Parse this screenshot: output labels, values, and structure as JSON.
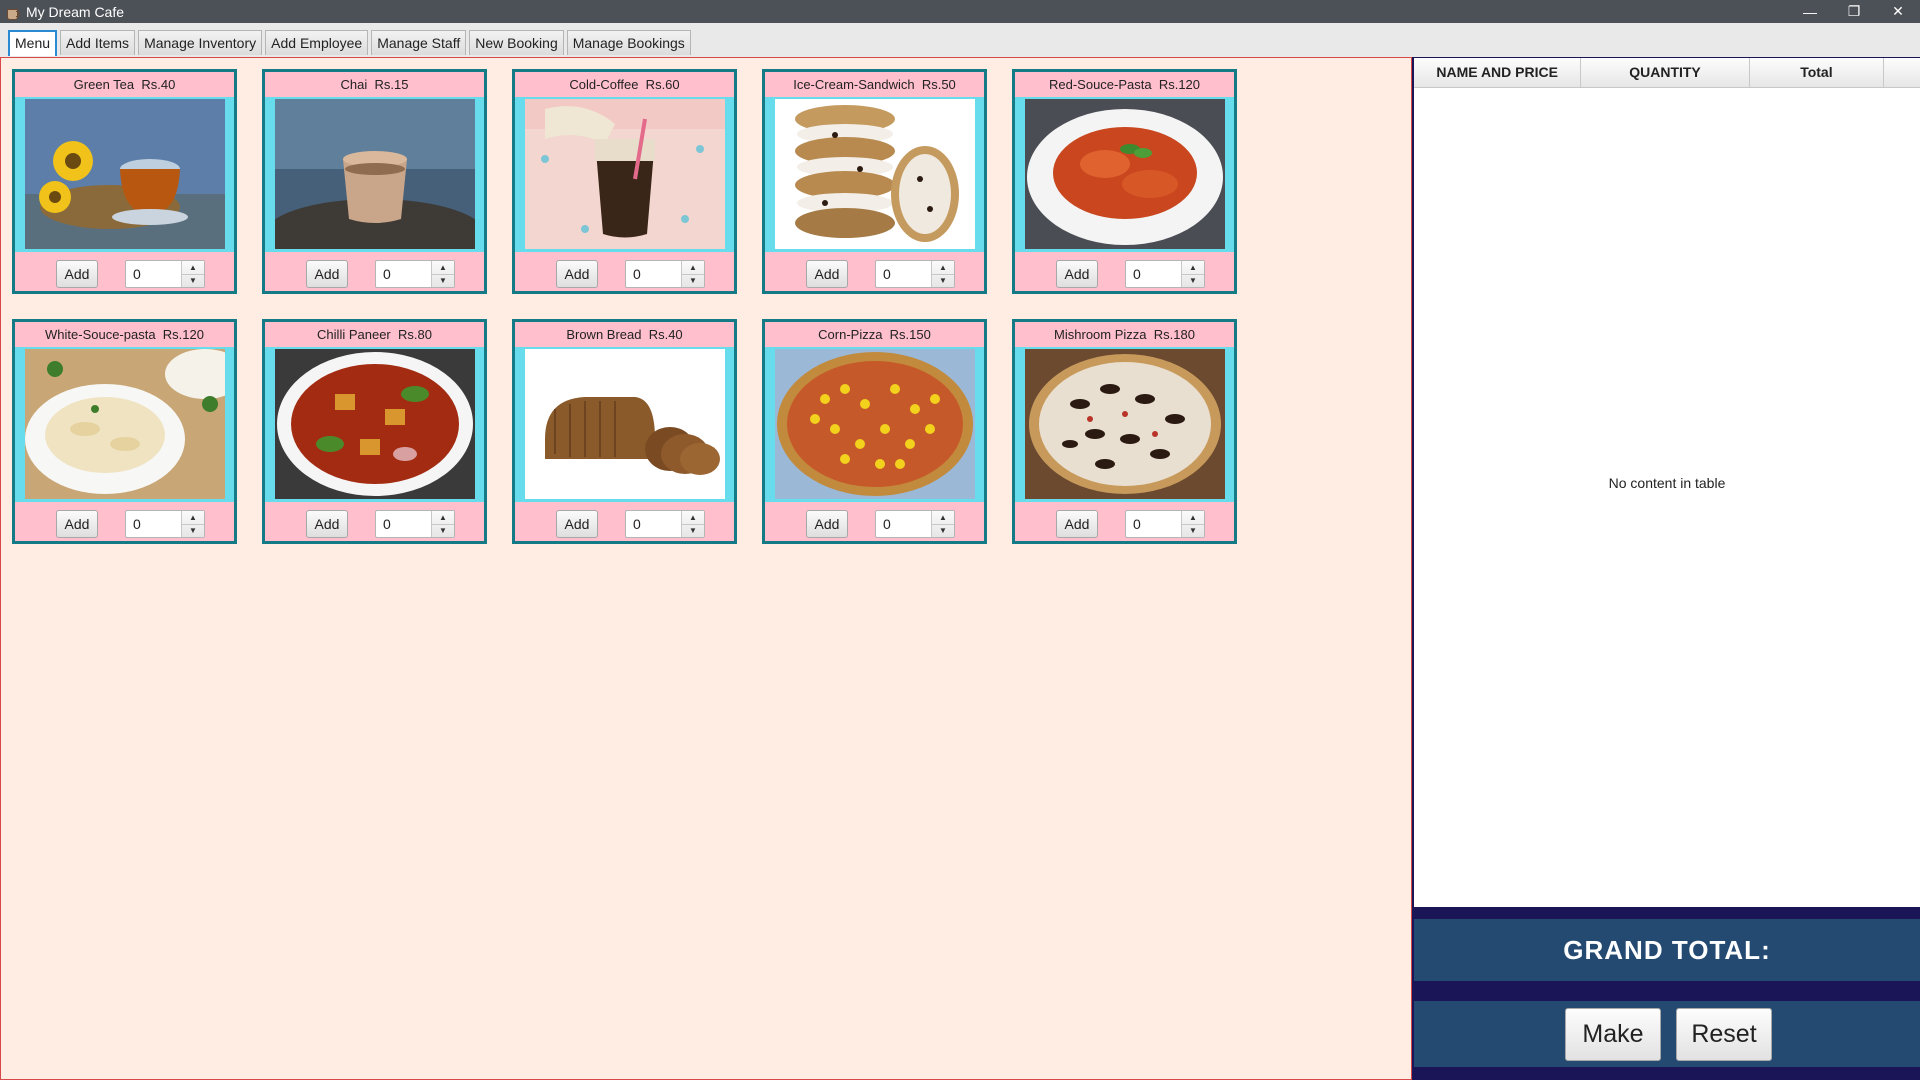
{
  "window": {
    "title": "My Dream Cafe",
    "controls": {
      "minimize": "—",
      "restore": "❐",
      "close": "✕"
    }
  },
  "tabs": [
    "Menu",
    "Add Items",
    "Manage Inventory",
    "Add Employee",
    "Manage Staff",
    "New Booking",
    "Manage Bookings"
  ],
  "active_tab": "Menu",
  "add_label": "Add",
  "menu_items": [
    {
      "name": "Green Tea",
      "price": "Rs.40",
      "label": "Green Tea  Rs.40",
      "qty": "0"
    },
    {
      "name": "Chai",
      "price": "Rs.15",
      "label": "Chai  Rs.15",
      "qty": "0"
    },
    {
      "name": "Cold-Coffee",
      "price": "Rs.60",
      "label": "Cold-Coffee  Rs.60",
      "qty": "0"
    },
    {
      "name": "Ice-Cream-Sandwich",
      "price": "Rs.50",
      "label": "Ice-Cream-Sandwich  Rs.50",
      "qty": "0"
    },
    {
      "name": "Red-Souce-Pasta",
      "price": "Rs.120",
      "label": "Red-Souce-Pasta  Rs.120",
      "qty": "0"
    },
    {
      "name": "White-Souce-pasta",
      "price": "Rs.120",
      "label": "White-Souce-pasta  Rs.120",
      "qty": "0"
    },
    {
      "name": "Chilli Paneer",
      "price": "Rs.80",
      "label": "Chilli Paneer  Rs.80",
      "qty": "0"
    },
    {
      "name": "Brown Bread",
      "price": "Rs.40",
      "label": "Brown Bread  Rs.40",
      "qty": "0"
    },
    {
      "name": "Corn-Pizza",
      "price": "Rs.150",
      "label": "Corn-Pizza  Rs.150",
      "qty": "0"
    },
    {
      "name": "Mishroom Pizza",
      "price": "Rs.180",
      "label": "Mishroom Pizza  Rs.180",
      "qty": "0"
    }
  ],
  "order_table": {
    "columns": [
      "NAME AND PRICE",
      "QUANTITY",
      "Total",
      ""
    ],
    "empty_message": "No content in table"
  },
  "grand_total_label": "GRAND TOTAL:",
  "buttons": {
    "make": "Make",
    "reset": "Reset"
  },
  "colors": {
    "titlebar": "#4c5157",
    "menu_bg": "#ffede3",
    "card_border": "#137a86",
    "card_bg": "#ffbfcd",
    "image_frame": "#66dcec",
    "total_panel": "#254a72",
    "order_panel_frame": "#191556"
  }
}
